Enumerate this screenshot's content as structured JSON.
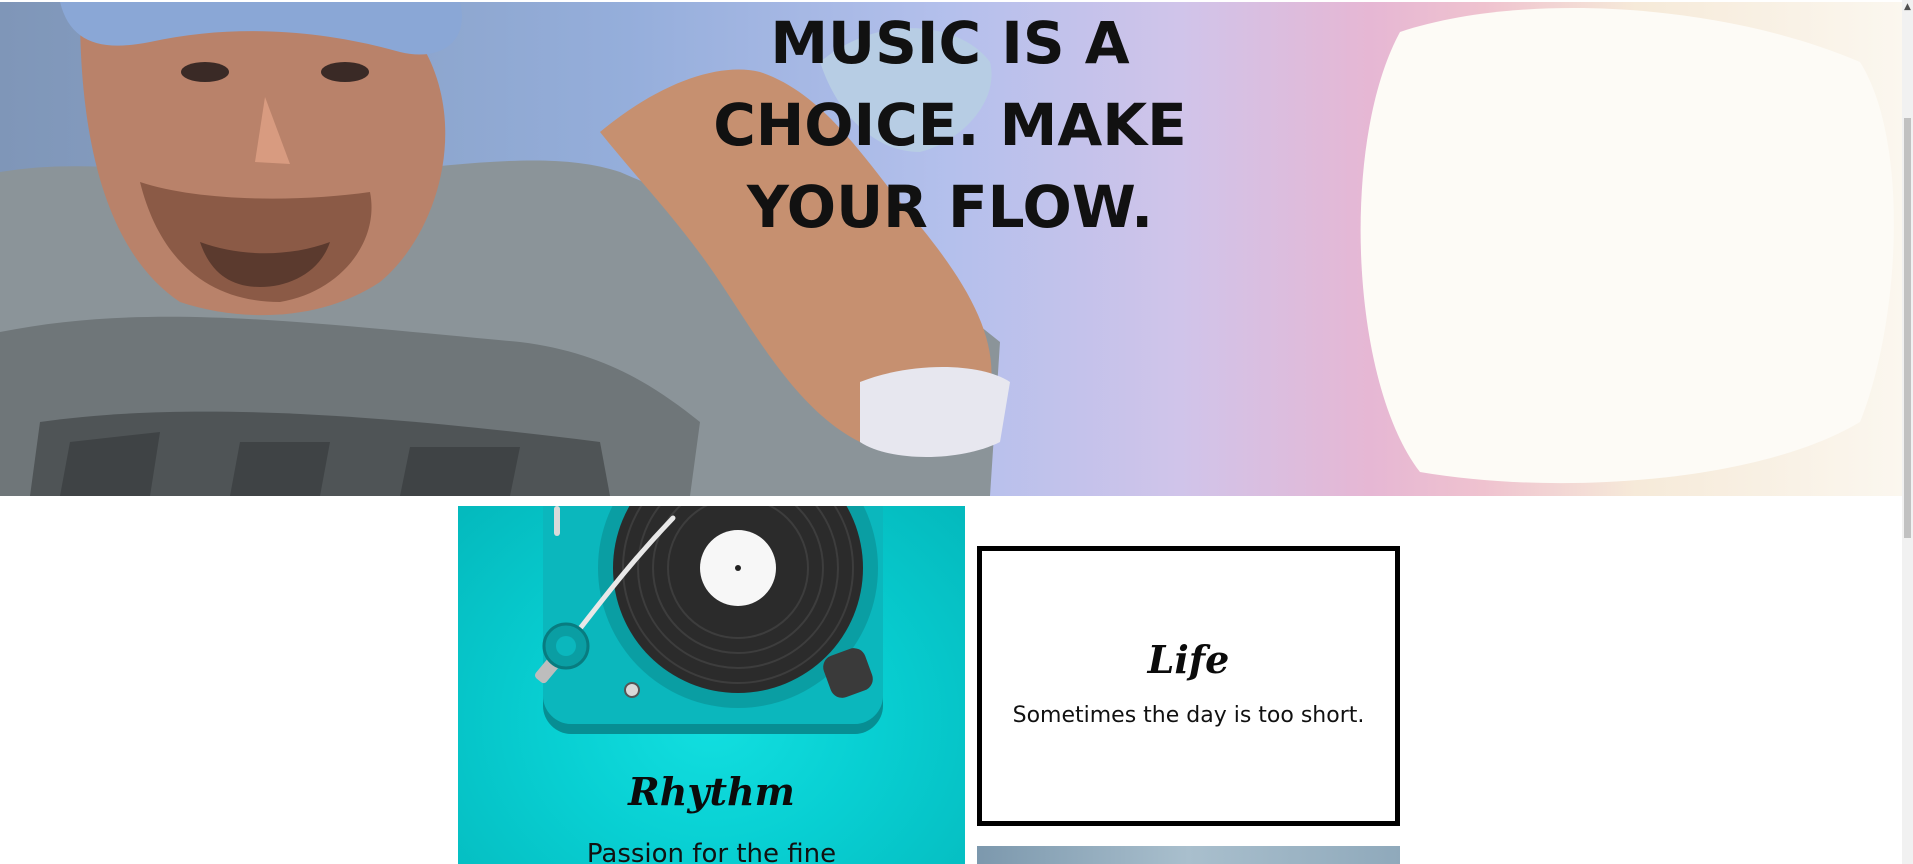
{
  "hero": {
    "title": "MUSIC IS A CHOICE. MAKE YOUR FLOW."
  },
  "tiles": [
    {
      "heading": "Rhythm",
      "text": "Passion for the fine"
    },
    {
      "heading": "Life",
      "text": "Sometimes the day is too short."
    }
  ],
  "scrollbar": {
    "up_glyph": "▲"
  },
  "colors": {
    "tile_teal": "#08cfd2",
    "border": "#000000",
    "text": "#111111"
  }
}
